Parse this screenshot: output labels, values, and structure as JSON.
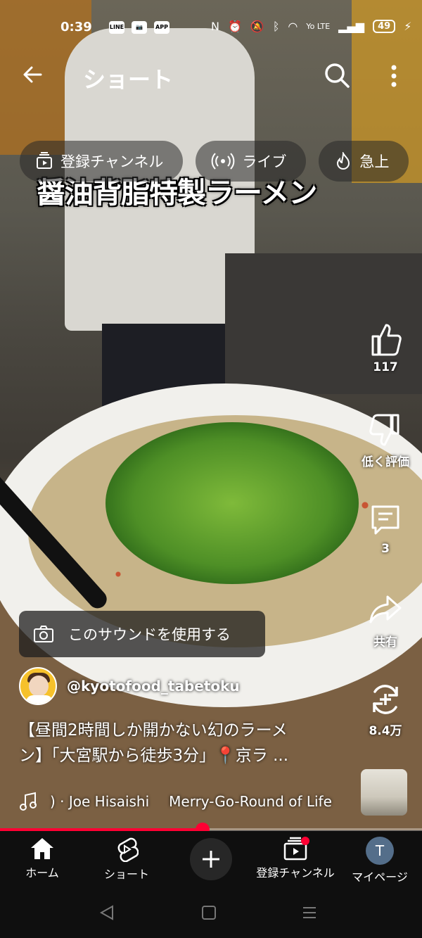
{
  "status_bar": {
    "time": "0:39",
    "left_icons": [
      "LINE",
      "📷",
      "APP"
    ],
    "battery": "49",
    "network": "Yo LTE"
  },
  "top_bar": {
    "title": "ショート"
  },
  "video": {
    "overlay_title": "醤油背脂特製ラーメン"
  },
  "chips": [
    {
      "label": "登録チャンネル",
      "icon": "subscriptions-icon"
    },
    {
      "label": "ライブ",
      "icon": "live-icon"
    },
    {
      "label": "急上",
      "icon": "trending-icon"
    }
  ],
  "actions": {
    "like_count": "117",
    "dislike_label": "低く評価",
    "comments_count": "3",
    "share_label": "共有",
    "remix_count": "8.4万"
  },
  "sound": {
    "label": "このサウンドを使用する"
  },
  "channel": {
    "handle": "@kyotofood_tabetoku"
  },
  "description": {
    "line1": "【昼間2時間しか開かない幻のラーメ",
    "line2": "ン】「大宮駅から徒歩3分」📍京ラ ..."
  },
  "music": {
    "artist": ") · Joe Hisaishi",
    "track": "Merry-Go-Round of Life"
  },
  "progress": {
    "fraction": 0.48
  },
  "bottom_nav": {
    "home": "ホーム",
    "shorts": "ショート",
    "subscriptions": "登録チャンネル",
    "profile": "マイページ",
    "profile_initial": "T"
  },
  "colors": {
    "accent": "#ff0033",
    "nav_bg": "#0f0f0f"
  }
}
